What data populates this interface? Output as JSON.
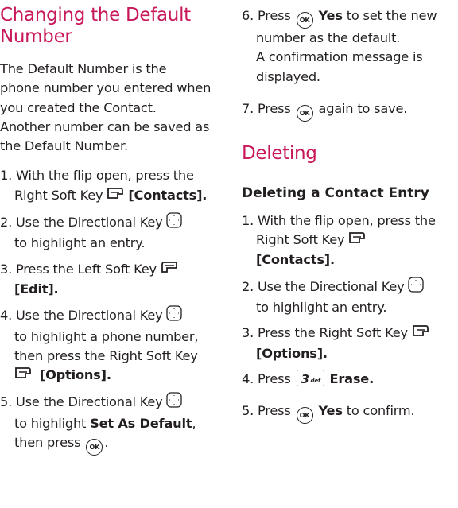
{
  "left": {
    "heading": "Changing the Default Number",
    "heading_line1": "Changing the Default",
    "heading_line2": "Number",
    "intro_l1": "The Default Number is the",
    "intro_l2": "phone number you entered when",
    "intro_l3": "you created the Contact.",
    "intro_l4": "Another number can be saved as",
    "intro_l5": "the Default Number.",
    "steps": {
      "s1_a": "1. With the flip open, press the",
      "s1_b": "Right Soft Key",
      "s1_c": "[Contacts].",
      "s2_a": "2. Use the Directional Key",
      "s2_b": "to highlight an entry.",
      "s3_a": "3. Press the Left Soft Key",
      "s3_b": "[Edit].",
      "s4_a": "4. Use the Directional Key",
      "s4_b": "to highlight a phone number,",
      "s4_c": "then press the Right Soft Key",
      "s4_d": "[Options].",
      "s5_a": "5. Use the Directional Key",
      "s5_b": "to highlight",
      "s5_c": "Set As Default",
      "s5_d": ",",
      "s5_e": "then press",
      "s5_f": "."
    }
  },
  "right": {
    "s6_a": "6. Press",
    "s6_b": "Yes",
    "s6_c": "to set the new",
    "s6_d": "number as the default.",
    "s6_e": "A confirmation message is",
    "s6_f": "displayed.",
    "s7_a": "7. Press",
    "s7_b": "again to save.",
    "heading": "Deleting",
    "sub_heading": "Deleting a Contact Entry",
    "d1_a": "1. With the flip open, press the",
    "d1_b": "Right Soft Key",
    "d1_c": "[Contacts].",
    "d2_a": "2. Use the Directional Key",
    "d2_b": "to highlight an entry.",
    "d3_a": "3. Press the Right Soft Key",
    "d3_b": "[Options].",
    "d4_a": "4. Press",
    "d4_b": "Erase.",
    "d5_a": "5. Press",
    "d5_b": "Yes",
    "d5_c": "to confirm."
  },
  "icons": {
    "ok_label": "OK",
    "key3_num": "3",
    "key3_sup": "def"
  }
}
